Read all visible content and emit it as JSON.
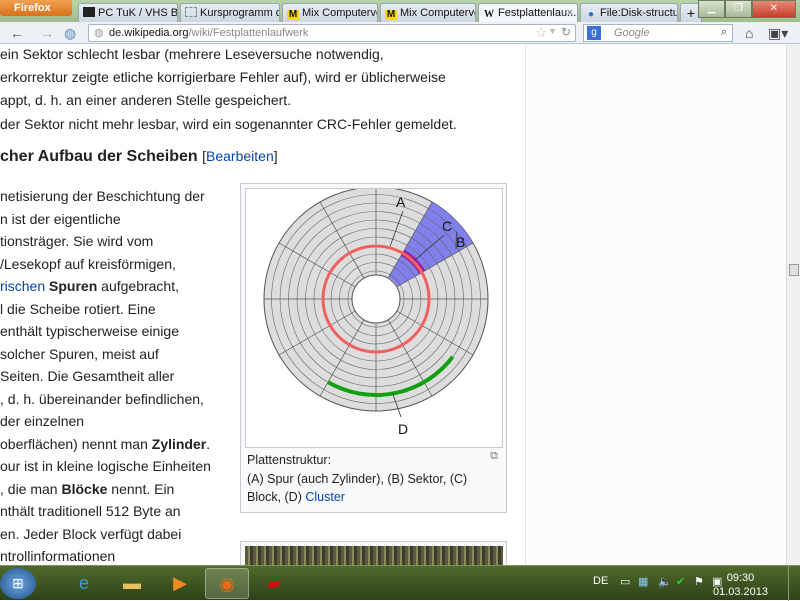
{
  "browser": {
    "menu_button": "Firefox",
    "tabs": [
      {
        "label": "PC TuK / VHS BS ...",
        "icon": "terminal-icon"
      },
      {
        "label": "Kursprogramm d...",
        "icon": "page-icon"
      },
      {
        "label": "Mix Computerver...",
        "icon": "m-logo-icon"
      },
      {
        "label": "Mix Computerver...",
        "icon": "m-logo-icon"
      },
      {
        "label": "Festplattenlau...",
        "icon": "wikipedia-icon",
        "active": true
      },
      {
        "label": "File:Disk-structur...",
        "icon": "firefox-icon"
      }
    ],
    "new_tab": "+",
    "url_host": "de.",
    "url_domain": "wikipedia.org",
    "url_path": "/wiki/Festplattenlaufwerk",
    "search_placeholder": "Google"
  },
  "article": {
    "top_lines": [
      "ein Sektor schlecht lesbar (mehrere Leseversuche notwendig,",
      "erkorrektur zeigte etliche korrigierbare Fehler auf), wird er üblicherweise",
      "appt, d. h. an einer anderen Stelle gespeichert.",
      "der Sektor nicht mehr lesbar, wird ein sogenannter CRC-Fehler gemeldet."
    ],
    "heading": "cher Aufbau der Scheiben",
    "edit_open": "[",
    "edit_link": "Bearbeiten",
    "edit_close": "]",
    "para": [
      {
        "t": "netisierung der Beschichtung der"
      },
      {
        "t": "n ist der eigentliche"
      },
      {
        "t": "tionsträger. Sie wird vom"
      },
      {
        "t": "/Lesekopf auf kreisförmigen,"
      },
      {
        "link": "rischen",
        "bold": "Spuren",
        "t": " aufgebracht,"
      },
      {
        "t": "l die Scheibe rotiert. Eine"
      },
      {
        "t": " enthält typischerweise einige"
      },
      {
        "t": " solcher Spuren, meist auf"
      },
      {
        "t": "Seiten. Die Gesamtheit aller"
      },
      {
        "t": ", d. h. übereinander befindlichen,"
      },
      {
        "t": "der einzelnen"
      },
      {
        "pre": "oberflächen) nennt man ",
        "bold": "Zylinder",
        "t": "."
      },
      {
        "t": "our ist in kleine logische Einheiten"
      },
      {
        "pre": ", die man ",
        "bold": "Blöcke",
        "t": " nennt. Ein"
      },
      {
        "t": "nthält traditionell 512 Byte an"
      },
      {
        "t": "en. Jeder Block verfügt dabei"
      },
      {
        "t": "ntrollinformationen"
      }
    ],
    "figure": {
      "labels": {
        "a": "A",
        "b": "B",
        "c": "C",
        "d": "D"
      },
      "caption_title": "Plattenstruktur:",
      "caption_1": "(A) Spur (auch Zylinder), (B) Sektor, (C)",
      "caption_2": "Block, (D) ",
      "caption_link": "Cluster"
    }
  },
  "taskbar": {
    "lang": "DE",
    "time": "09:30",
    "date": "01.03.2013"
  }
}
